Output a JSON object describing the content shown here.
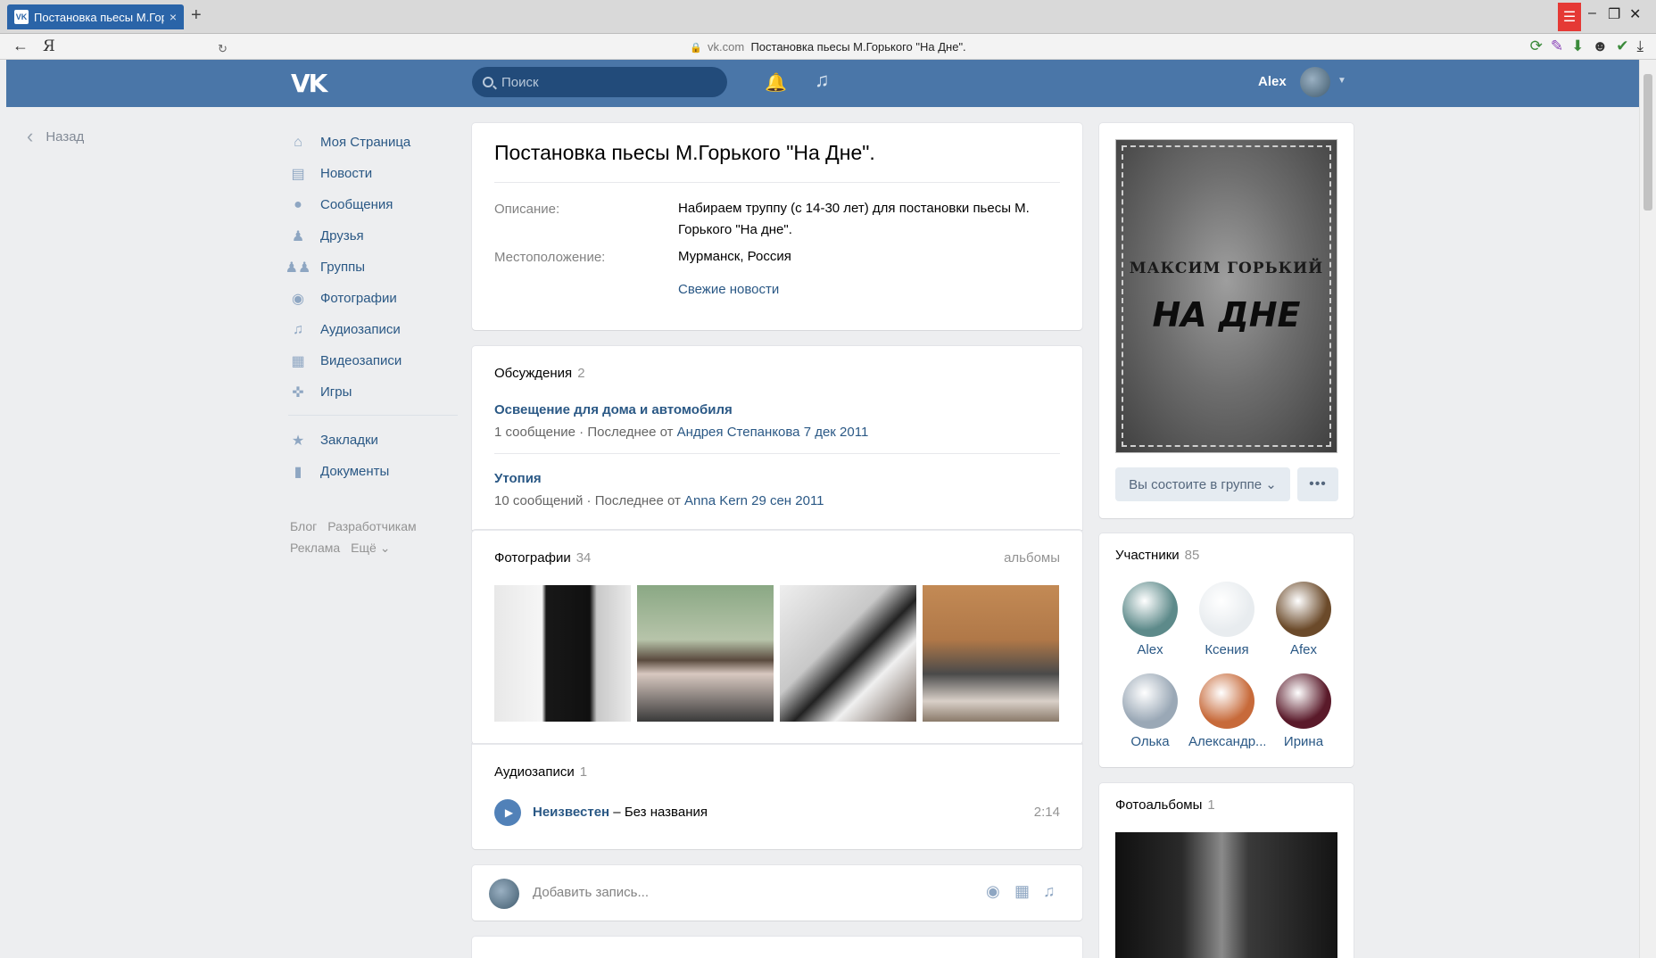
{
  "browser": {
    "tab_title": "Постановка пьесы М.Горького",
    "tab_close": "×",
    "new_tab": "+",
    "yandex_logo": "Я",
    "url_domain": "vk.com",
    "url_title": "Постановка пьесы М.Горького \"На Дне\"."
  },
  "header": {
    "logo": "VK",
    "search_placeholder": "Поиск",
    "user_name": "Alex"
  },
  "back_link": "Назад",
  "nav": {
    "items": [
      {
        "label": "Моя Страница",
        "icon": "home-icon"
      },
      {
        "label": "Новости",
        "icon": "news-icon"
      },
      {
        "label": "Сообщения",
        "icon": "messages-icon"
      },
      {
        "label": "Друзья",
        "icon": "friends-icon"
      },
      {
        "label": "Группы",
        "icon": "groups-icon"
      },
      {
        "label": "Фотографии",
        "icon": "camera-icon"
      },
      {
        "label": "Аудиозаписи",
        "icon": "music-note-icon"
      },
      {
        "label": "Видеозаписи",
        "icon": "film-icon"
      },
      {
        "label": "Игры",
        "icon": "gamepad-icon"
      }
    ],
    "extra_items": [
      {
        "label": "Закладки",
        "icon": "star-icon"
      },
      {
        "label": "Документы",
        "icon": "document-icon"
      }
    ],
    "footer": [
      "Блог",
      "Разработчикам",
      "Реклама",
      "Ещё ⌄"
    ]
  },
  "group": {
    "title": "Постановка пьесы М.Горького \"На Дне\".",
    "description_label": "Описание:",
    "description": "Набираем труппу (с 14-30 лет) для постановки пьесы М. Горького \"На дне\".",
    "location_label": "Местоположение:",
    "location": "Мурманск, Россия",
    "fresh_news": "Свежие новости"
  },
  "discussions": {
    "title": "Обсуждения",
    "count": "2",
    "topics": [
      {
        "title": "Освещение для дома и автомобиля",
        "messages": "1 сообщение",
        "last_prefix": "Последнее от",
        "author": "Андрея Степанкова",
        "date": "7 дек 2011"
      },
      {
        "title": "Утопия",
        "messages": "10 сообщений",
        "last_prefix": "Последнее от",
        "author": "Anna Kern",
        "date": "29 сен 2011"
      }
    ]
  },
  "photos": {
    "title": "Фотографии",
    "count": "34",
    "albums_link": "альбомы"
  },
  "audio": {
    "title": "Аудиозаписи",
    "count": "1",
    "artist": "Неизвестен",
    "separator": "–",
    "track": "Без названия",
    "duration": "2:14"
  },
  "post": {
    "placeholder": "Добавить запись..."
  },
  "cover": {
    "author": "МАКСИМ ГОРЬКИЙ",
    "play": "НА ДНЕ",
    "member_button": "Вы состоите в группе ⌄",
    "more_button": "•••"
  },
  "members": {
    "title": "Участники",
    "count": "85",
    "list": [
      {
        "name": "Alex",
        "color": "#5d8a8a"
      },
      {
        "name": "Ксения",
        "color": "#e8ecef"
      },
      {
        "name": "Afex",
        "color": "#6b4a2a"
      },
      {
        "name": "Олька",
        "color": "#9aa8b6"
      },
      {
        "name": "Александр...",
        "color": "#c76a3a"
      },
      {
        "name": "Ирина",
        "color": "#5a1a2a"
      }
    ]
  },
  "albums": {
    "title": "Фотоальбомы",
    "count": "1"
  },
  "colors": {
    "vk_blue": "#4a76a8",
    "link": "#2a5885",
    "background": "#edeef0"
  }
}
